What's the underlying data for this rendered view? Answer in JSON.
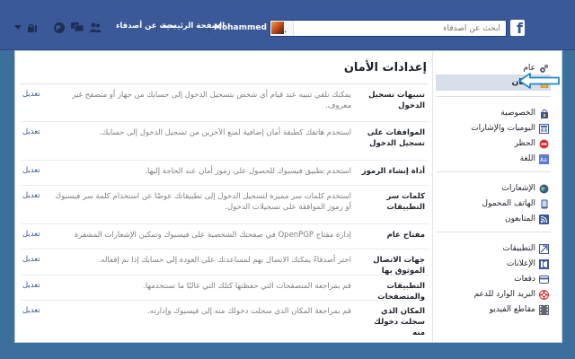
{
  "topbar": {
    "logo": "f",
    "search_placeholder": "ابحث عن أصدقاء",
    "user_name": "Mohammed",
    "home_link": "الصفحة الرئيسية",
    "find_friends_link": "بحث عن أصدقاء"
  },
  "page": {
    "title": "إعدادات الأمان"
  },
  "settings": [
    {
      "label": "تنبيهات تسجيل الدخول",
      "desc": "يمكنك تلقي تنبيه عند قيام أي شخص بتسجيل الدخول إلى حسابك من جهاز أو متصفح غير معروف.",
      "edit": "تعديل"
    },
    {
      "label": "الموافقات على تسجيل الدخول",
      "desc": "استخدم هاتفك كطبقة أمان إضافية لمنع الآخرين من تسجيل الدخول إلى حسابك.",
      "edit": "تعديل"
    },
    {
      "label": "أداة إنشاء الرموز",
      "desc": "استخدم تطبيق فيسبوك للحصول على رموز أمان عند الحاجة إليها.",
      "edit": "تعديل"
    },
    {
      "label": "كلمات سر التطبيقات",
      "desc": "استخدم كلمات سر مميزة لتسجيل الدخول إلى تطبيقاتك عوضًا عن استخدام كلمة سر فيسبوك أو رموز الموافقة على تسجيلات الدخول.",
      "edit": "تعديل"
    },
    {
      "label": "مفتاح عام",
      "desc": "إدارة مفتاح OpenPGP في صفحتك الشخصية على فيسبوك وتمكين الإشعارات المشفرة",
      "edit": "تعديل"
    },
    {
      "label": "جهات الاتصال الموثوق بها",
      "desc": "اختر أصدقاءً يمكنك الاتصال بهم لمساعدتك على العودة إلى حسابك إذا تم إقفاله.",
      "edit": "تعديل"
    },
    {
      "label": "التطبيقات والمتصفحات",
      "desc": "قم بمراجعة المتصفحات التي حفظتها كتلك التي غالبًا ما تستخدمها.",
      "edit": "تعديل"
    },
    {
      "label": "المكان الذي سجلت دخولك منه",
      "desc": "قم بمراجعة المكان الذي سجلت دخولك منه إلى فيسبوك وإدارته.",
      "edit": "تعديل"
    }
  ],
  "sidebar": {
    "group1": [
      {
        "label": "عام",
        "icon": "gear-icon",
        "active": false
      },
      {
        "label": "الأمان",
        "icon": "lock-icon",
        "active": true
      }
    ],
    "group2": [
      {
        "label": "الخصوصية",
        "icon": "privacy-lock-icon"
      },
      {
        "label": "اليوميات والإشارات",
        "icon": "timeline-icon"
      },
      {
        "label": "الحظر",
        "icon": "block-icon"
      },
      {
        "label": "اللغة",
        "icon": "language-icon"
      }
    ],
    "group3": [
      {
        "label": "الإشعارات",
        "icon": "globe-icon"
      },
      {
        "label": "الهاتف المحمول",
        "icon": "mobile-icon"
      },
      {
        "label": "المتابعون",
        "icon": "rss-icon"
      }
    ],
    "group4": [
      {
        "label": "التطبيقات",
        "icon": "apps-icon"
      },
      {
        "label": "الإعلانات",
        "icon": "ads-icon"
      },
      {
        "label": "دفعات",
        "icon": "payments-icon"
      },
      {
        "label": "البريد الوارد للدعم",
        "icon": "lifebuoy-icon"
      },
      {
        "label": "مقاطع الفيديو",
        "icon": "video-icon"
      }
    ]
  },
  "colors": {
    "brand": "#3b5998",
    "link": "#365899",
    "active_bg": "#d8dfea",
    "arrow": "#1e88c8"
  }
}
